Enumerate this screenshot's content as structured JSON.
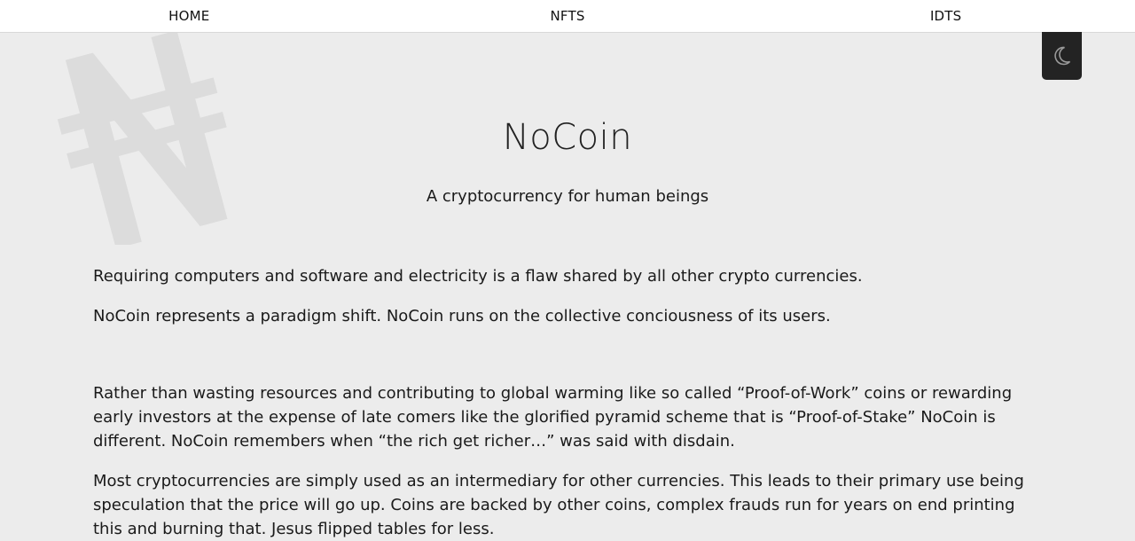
{
  "nav": {
    "items": [
      "HOME",
      "NFTS",
      "IDTS"
    ]
  },
  "theme_toggle": {
    "icon": "moon-icon"
  },
  "hero": {
    "title": "NoCoin",
    "subtitle": "A cryptocurrency for human beings",
    "logo_icon": "naira-sign-icon",
    "logo_glyph": "₦"
  },
  "content": {
    "paragraphs": [
      "Requiring computers and software and electricity is a flaw shared by all other crypto currencies.",
      "NoCoin represents a paradigm shift. NoCoin runs on the collective conciousness of its users.",
      "Rather than wasting resources and contributing to global warming like so called “Proof-of-Work” coins or rewarding early investors at the expense of late comers like the glorified pyramid scheme that is “Proof-of-Stake” NoCoin is different. NoCoin remembers when “the rich get richer…” was said with disdain.",
      "Most cryptocurrencies are simply used as an intermediary for other currencies. This leads to their primary use being speculation that the price will go up. Coins are backed by other coins, complex frauds run for years on end printing this and burning that. Jesus flipped tables for less."
    ]
  },
  "colors": {
    "background": "#ececec",
    "nav_background": "#ffffff",
    "toggle_background": "#232323",
    "logo_color": "#dcdcdc",
    "text": "#1a1a1a"
  }
}
